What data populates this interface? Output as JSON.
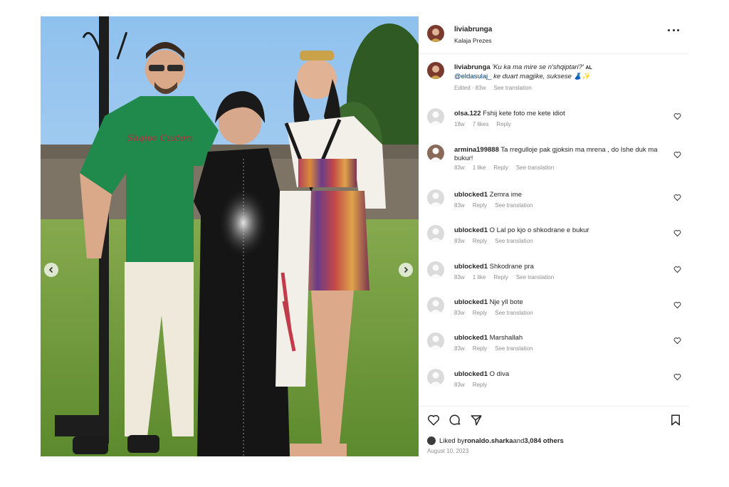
{
  "post": {
    "username": "liviabrunga",
    "location": "Kalaja Prezes",
    "caption_user": "liviabrunga",
    "caption_text": "'Ku ka ma mire se n'shqiptari?' ",
    "caption_flag": "AL",
    "caption_mention": "@eldasulaj_",
    "caption_rest": " ke duart magjike, suksese 👗✨",
    "caption_edited": "Edited · 83w",
    "caption_translate": "See translation"
  },
  "comments": [
    {
      "user": "olsa.122",
      "text": "Fshij kete foto me kete idiot",
      "time": "18w",
      "likes": "7 likes",
      "reply": "Reply",
      "translate": ""
    },
    {
      "user": "armina199888",
      "text": "Ta rregulloje pak gjoksin ma mrena , do Ishe duk ma bukur!",
      "time": "83w",
      "likes": "1 like",
      "reply": "Reply",
      "translate": "See translation"
    },
    {
      "user": "ublocked1",
      "text": "Zemra ime",
      "time": "83w",
      "likes": "",
      "reply": "Reply",
      "translate": "See translation"
    },
    {
      "user": "ublocked1",
      "text": "O Lal po kjo o shkodrane e bukur",
      "time": "83w",
      "likes": "",
      "reply": "Reply",
      "translate": "See translation"
    },
    {
      "user": "ublocked1",
      "text": "Shkodrane pra",
      "time": "83w",
      "likes": "1 like",
      "reply": "Reply",
      "translate": "See translation"
    },
    {
      "user": "ublocked1",
      "text": "Nje yll bote",
      "time": "83w",
      "likes": "",
      "reply": "Reply",
      "translate": "See translation"
    },
    {
      "user": "ublocked1",
      "text": "Marshallah",
      "time": "83w",
      "likes": "",
      "reply": "Reply",
      "translate": "See translation"
    },
    {
      "user": "ublocked1",
      "text": "O diva",
      "time": "83w",
      "likes": "",
      "reply": "Reply",
      "translate": ""
    }
  ],
  "footer": {
    "liked_prefix": "Liked by ",
    "liked_user": "ronaldo.sharka",
    "liked_and": " and ",
    "liked_others": "3,084 others",
    "date": "August 10, 2023"
  },
  "photo": {
    "shirt_text": "Shqipe Custom",
    "colors": {
      "sky": "#9cc7ee",
      "grass": "#6f9a3c",
      "green_shirt": "#1f8a4c",
      "black_dress": "#151515"
    }
  },
  "icons": {
    "more": "more-horizontal-icon",
    "heart": "heart-icon",
    "comment": "comment-icon",
    "share": "paper-plane-icon",
    "save": "bookmark-icon",
    "prev": "chevron-left-icon",
    "next": "chevron-right-icon"
  }
}
